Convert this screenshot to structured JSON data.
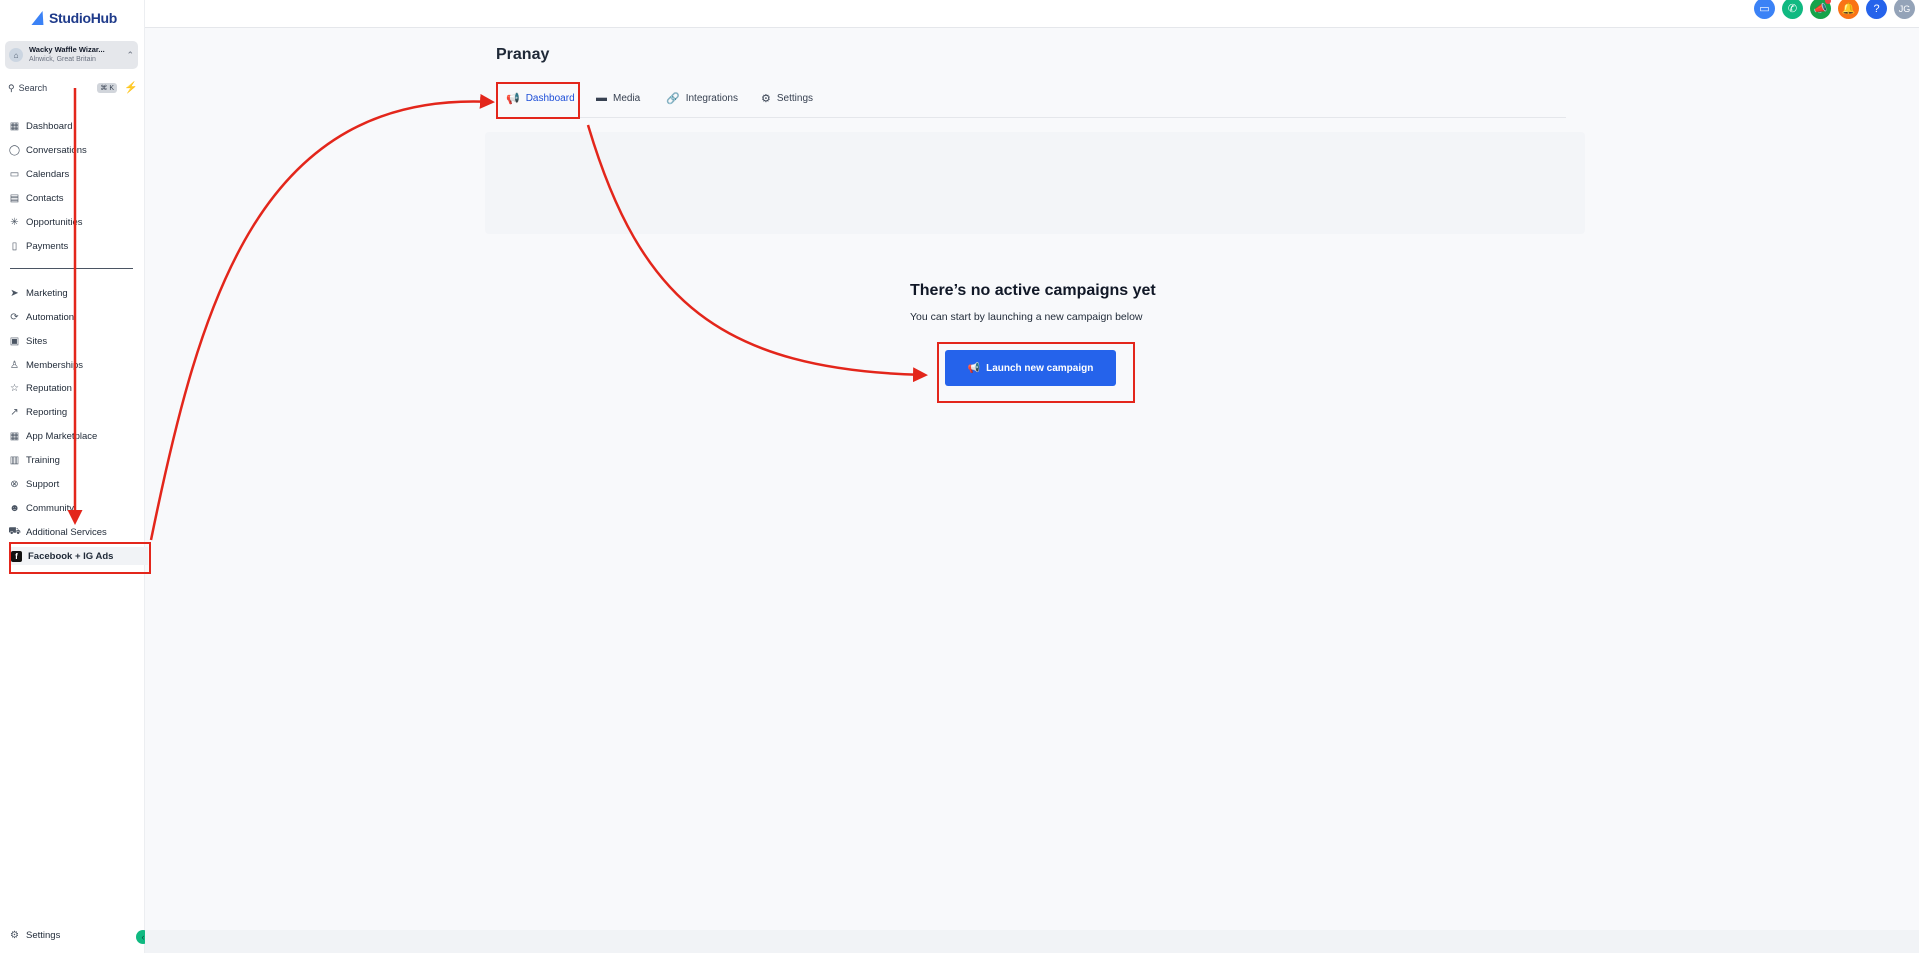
{
  "brand": {
    "name": "StudioHub"
  },
  "account": {
    "name": "Wacky Waffle Wizar...",
    "location": "Alnwick, Great Britain"
  },
  "search": {
    "label": "Search",
    "shortcut": "⌘ K"
  },
  "sidebar": {
    "items": [
      {
        "label": "Dashboard",
        "icon": "grid-icon"
      },
      {
        "label": "Conversations",
        "icon": "chat-icon"
      },
      {
        "label": "Calendars",
        "icon": "calendar-icon"
      },
      {
        "label": "Contacts",
        "icon": "contacts-icon"
      },
      {
        "label": "Opportunities",
        "icon": "opportunities-icon"
      },
      {
        "label": "Payments",
        "icon": "payments-icon"
      },
      {
        "label": "Marketing",
        "icon": "send-icon"
      },
      {
        "label": "Automation",
        "icon": "automation-icon"
      },
      {
        "label": "Sites",
        "icon": "sites-icon"
      },
      {
        "label": "Memberships",
        "icon": "memberships-icon"
      },
      {
        "label": "Reputation",
        "icon": "star-icon"
      },
      {
        "label": "Reporting",
        "icon": "trend-icon"
      },
      {
        "label": "App Marketplace",
        "icon": "apps-icon"
      },
      {
        "label": "Training",
        "icon": "book-icon"
      },
      {
        "label": "Support",
        "icon": "lifebuoy-icon"
      },
      {
        "label": "Community",
        "icon": "people-icon"
      },
      {
        "label": "Additional Services",
        "icon": "cart-icon"
      },
      {
        "label": "Facebook + IG Ads",
        "icon": "facebook-icon"
      }
    ],
    "settings_label": "Settings"
  },
  "topbar": {
    "avatar_initials": "JG",
    "help_label": "?"
  },
  "page": {
    "title": "Pranay"
  },
  "tabs": [
    {
      "label": "Dashboard"
    },
    {
      "label": "Media"
    },
    {
      "label": "Integrations"
    },
    {
      "label": "Settings"
    }
  ],
  "empty_state": {
    "title": "There’s no active campaigns yet",
    "subtitle": "You can start by launching a new campaign below",
    "button_label": "Launch new campaign"
  },
  "colors": {
    "primary": "#2563eb",
    "annotation": "#e3261b",
    "accent_green": "#10b981"
  }
}
